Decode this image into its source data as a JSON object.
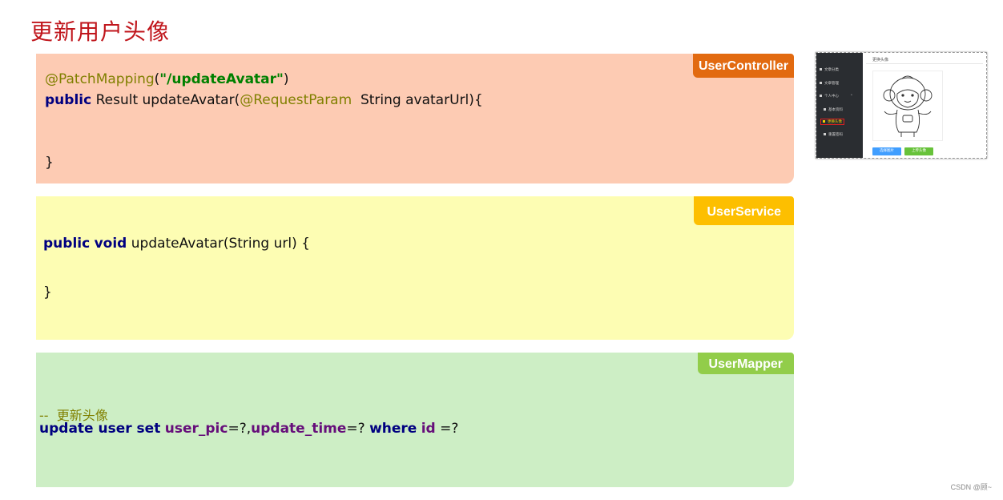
{
  "page": {
    "title": "更新用户头像",
    "watermark": "CSDN @顾~"
  },
  "controller": {
    "badge": "UserController",
    "line1_anno": "@PatchMapping",
    "line1_paren_open": "(",
    "line1_string": "\"/updateAvatar\"",
    "line1_paren_close": ")",
    "line2_kw": "public",
    "line2_text1": " Result updateAvatar(",
    "line2_anno": "@RequestParam",
    "line2_text2": "  String avatarUrl){",
    "close_brace": "}"
  },
  "service": {
    "badge": "UserService",
    "line1_kw1": "public",
    "line1_kw2": "void",
    "line1_text": " updateAvatar(String url) {",
    "close_brace": "}"
  },
  "mapper": {
    "badge": "UserMapper",
    "comment": "--  更新头像",
    "sql_kw1": "update user set",
    "sql_col1": "user_pic",
    "sql_mid1": "=?,",
    "sql_col2": "update_time",
    "sql_mid2": "=? ",
    "sql_kw2": "where",
    "sql_col3": "id",
    "sql_end": " =?"
  },
  "thumbnail": {
    "main_title": "更换头像",
    "sidebar_items": [
      {
        "label": "文章分类",
        "icon": "category-icon",
        "active": false
      },
      {
        "label": "文章管理",
        "icon": "article-icon",
        "active": false
      },
      {
        "label": "个人中心",
        "icon": "user-icon",
        "active": false
      },
      {
        "label": "基本资料",
        "icon": "profile-icon",
        "active": false
      },
      {
        "label": "更换头像",
        "icon": "crop-icon",
        "active": true
      },
      {
        "label": "重置密码",
        "icon": "edit-icon",
        "active": false
      }
    ],
    "select_button": "选择图片",
    "upload_button": "上传头像",
    "colors": {
      "sidebar_bg": "#2a2d31",
      "select_btn": "#409eff",
      "upload_btn": "#67c23a",
      "active_text": "#f2d000"
    }
  }
}
